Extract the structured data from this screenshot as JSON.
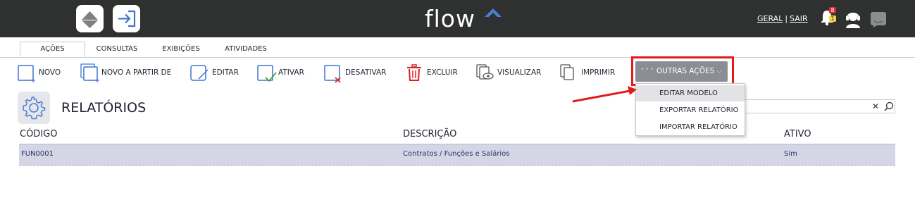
{
  "brand": {
    "name": "flow"
  },
  "top_links": {
    "geral": "GERAL",
    "separator": "|",
    "sair": "SAIR"
  },
  "notifications": {
    "red_count": "8",
    "yellow_count": "1"
  },
  "tabs": [
    {
      "label": "AÇÕES",
      "active": true
    },
    {
      "label": "CONSULTAS",
      "active": false
    },
    {
      "label": "EXIBIÇÕES",
      "active": false
    },
    {
      "label": "ATIVIDADES",
      "active": false
    }
  ],
  "toolbar": {
    "novo": "NOVO",
    "novo_a_partir": "NOVO A PARTIR DE",
    "editar": "EDITAR",
    "ativar": "ATIVAR",
    "desativar": "DESATIVAR",
    "excluir": "EXCLUIR",
    "visualizar": "VISUALIZAR",
    "imprimir": "IMPRIMIR",
    "outras_acoes": "OUTRAS AÇÕES"
  },
  "outras_menu": [
    {
      "label": "EDITAR MODELO",
      "selected": true
    },
    {
      "label": "EXPORTAR RELATÓRIO",
      "selected": false
    },
    {
      "label": "IMPORTAR RELATÓRIO",
      "selected": false
    }
  ],
  "page": {
    "title": "RELATÓRIOS"
  },
  "search": {
    "value": "",
    "clear_glyph": "✕"
  },
  "table": {
    "columns": [
      "CÓDIGO",
      "DESCRIÇÃO",
      "ATIVO"
    ],
    "rows": [
      {
        "codigo": "FUN0001",
        "descricao": "Contratos / Funções e Salários",
        "ativo": "Sim"
      }
    ]
  },
  "colors": {
    "topbar": "#2f3030",
    "accent_blue": "#4a7fd4",
    "highlight_red": "#e41a1a",
    "selected_row": "#d4d6e6"
  }
}
